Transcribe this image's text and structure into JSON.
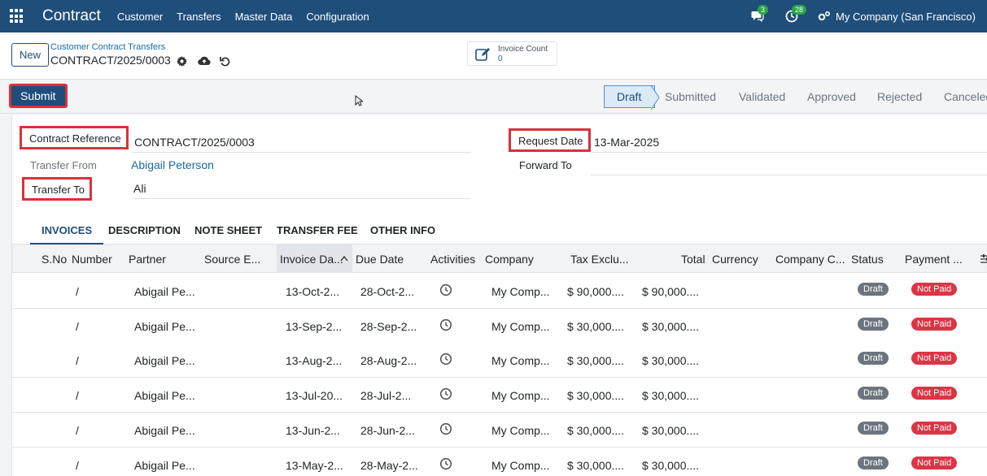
{
  "navbar": {
    "app_title": "Contract",
    "menu": [
      "Customer",
      "Transfers",
      "Master Data",
      "Configuration"
    ],
    "messages_count": "3",
    "activities_count": "28",
    "company": "My Company (San Francisco)"
  },
  "control": {
    "new_label": "New",
    "breadcrumb_parent": "Customer Contract Transfers",
    "breadcrumb_current": "CONTRACT/2025/0003",
    "stat_label": "Invoice Count",
    "stat_value": "0"
  },
  "statusbar": {
    "submit_label": "Submit",
    "stages": [
      "Draft",
      "Submitted",
      "Validated",
      "Approved",
      "Rejected",
      "Canceled"
    ],
    "active_stage": "Draft"
  },
  "form": {
    "contract_reference_label": "Contract Reference",
    "contract_reference_value": "CONTRACT/2025/0003",
    "transfer_from_label": "Transfer From",
    "transfer_from_value": "Abigail Peterson",
    "transfer_to_label": "Transfer To",
    "transfer_to_value": "Ali",
    "request_date_label": "Request Date",
    "request_date_value": "13-Mar-2025",
    "forward_to_label": "Forward To",
    "forward_to_value": ""
  },
  "tabs": [
    "INVOICES",
    "DESCRIPTION",
    "NOTE SHEET",
    "TRANSFER FEE",
    "OTHER INFO"
  ],
  "table": {
    "columns": [
      "S.No",
      "Number",
      "Partner",
      "Source E...",
      "Invoice Da...",
      "Due Date",
      "Activities",
      "Company",
      "Tax Exclu...",
      "Total",
      "Currency",
      "Company C...",
      "Status",
      "Payment ..."
    ],
    "rows": [
      {
        "number": "/",
        "partner": "Abigail Pe...",
        "invoice_date": "13-Oct-2...",
        "due_date": "28-Oct-2...",
        "company": "My Comp...",
        "tax_excl": "$ 90,000....",
        "total": "$ 90,000....",
        "status": "Draft",
        "payment": "Not Paid"
      },
      {
        "number": "/",
        "partner": "Abigail Pe...",
        "invoice_date": "13-Sep-2...",
        "due_date": "28-Sep-2...",
        "company": "My Comp...",
        "tax_excl": "$ 30,000....",
        "total": "$ 30,000....",
        "status": "Draft",
        "payment": "Not Paid"
      },
      {
        "number": "/",
        "partner": "Abigail Pe...",
        "invoice_date": "13-Aug-2...",
        "due_date": "28-Aug-2...",
        "company": "My Comp...",
        "tax_excl": "$ 30,000....",
        "total": "$ 30,000....",
        "status": "Draft",
        "payment": "Not Paid"
      },
      {
        "number": "/",
        "partner": "Abigail Pe...",
        "invoice_date": "13-Jul-20...",
        "due_date": "28-Jul-2...",
        "company": "My Comp...",
        "tax_excl": "$ 30,000....",
        "total": "$ 30,000....",
        "status": "Draft",
        "payment": "Not Paid"
      },
      {
        "number": "/",
        "partner": "Abigail Pe...",
        "invoice_date": "13-Jun-2...",
        "due_date": "28-Jun-2...",
        "company": "My Comp...",
        "tax_excl": "$ 30,000....",
        "total": "$ 30,000....",
        "status": "Draft",
        "payment": "Not Paid"
      },
      {
        "number": "/",
        "partner": "Abigail Pe...",
        "invoice_date": "13-May-2...",
        "due_date": "28-May-2...",
        "company": "My Comp...",
        "tax_excl": "$ 30,000....",
        "total": "$ 30,000....",
        "status": "Draft",
        "payment": "Not Paid"
      }
    ]
  },
  "colors": {
    "navbar": "#1f4e7a",
    "highlight": "#d9313b",
    "link": "#1f6a9e",
    "badge_success": "#28a745",
    "not_paid": "#dc3545",
    "draft": "#6c757d"
  },
  "icons": {
    "apps": "apps-grid-icon",
    "messages": "chat-icon",
    "activities": "clock-icon",
    "company_switch": "gears-icon",
    "settings": "gear-icon",
    "save": "cloud-upload-icon",
    "discard": "undo-icon",
    "invoice_count": "pencil-square-icon",
    "activity": "clock-icon",
    "column_settings": "sliders-icon"
  }
}
